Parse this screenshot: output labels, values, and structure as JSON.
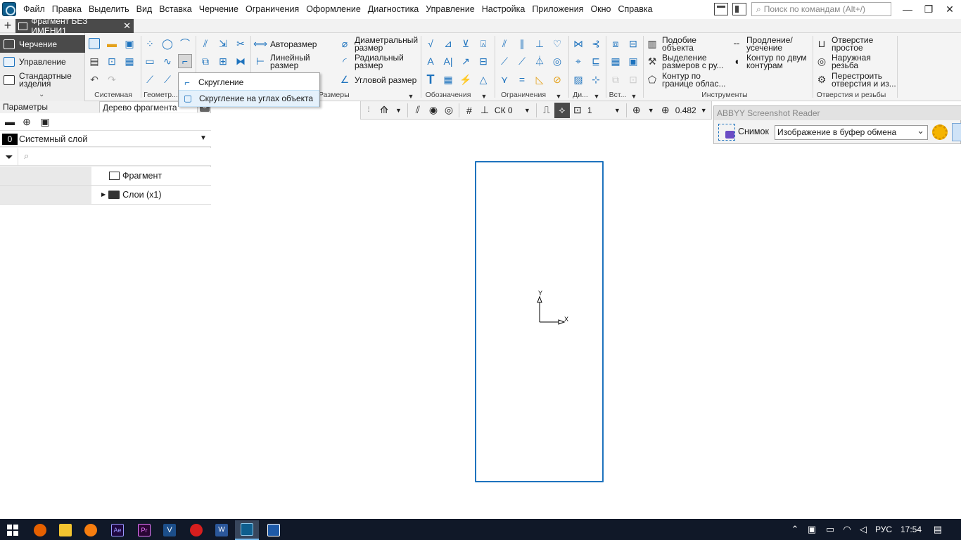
{
  "menu": {
    "items": [
      "Файл",
      "Правка",
      "Выделить",
      "Вид",
      "Вставка",
      "Черчение",
      "Ограничения",
      "Оформление",
      "Диагностика",
      "Управление",
      "Настройка",
      "Приложения",
      "Окно",
      "Справка"
    ],
    "search_placeholder": "Поиск по командам (Alt+/)"
  },
  "tabs": {
    "document_tab": "Фрагмент БЕЗ ИМЕНИ1"
  },
  "ribbon": {
    "left_tabs": [
      "Черчение",
      "Управление",
      "Стандартные изделия"
    ],
    "groups": [
      "Системная",
      "Геометр...",
      "Размеры",
      "Обозначения",
      "Ограничения",
      "Ди...",
      "Вст...",
      "Инструменты",
      "Отверстия и резьбы"
    ],
    "dimension_buttons": [
      "Авторазмер",
      "Линейный размер",
      "Диаметральный размер",
      "Радиальный размер",
      "Угловой размер"
    ],
    "tool_buttons": [
      "Подобие объекта",
      "Выделение размеров с ру...",
      "Контур по границе облас...",
      "Продление/ усечение",
      "Контур по двум контурам"
    ],
    "hole_buttons": [
      "Отверстие простое",
      "Наружная резьба",
      "Перестроить отверстия и из..."
    ]
  },
  "popup": {
    "items": [
      "Скругление",
      "Скругление на углах объекта"
    ]
  },
  "left_panel": {
    "tabs": [
      "Параметры",
      "Дерево фрагмента"
    ],
    "layer_number": "0",
    "layer_name": "Системный слой",
    "tree": [
      "Фрагмент",
      "Слои (x1)"
    ]
  },
  "view_toolbar": {
    "cs": "СК 0",
    "layer_value": "1",
    "zoom": "0.482"
  },
  "canvas": {
    "axis_x": "X",
    "axis_y": "Y"
  },
  "abbyy": {
    "title": "ABBYY Screenshot Reader",
    "label": "Снимок",
    "selected": "Изображение в буфер обмена"
  },
  "taskbar": {
    "tray_lang": "РУС",
    "tray_time": "17:54",
    "app_icons": [
      "windows-start",
      "firefox",
      "file-explorer",
      "avast",
      "after-effects",
      "premiere",
      "visio",
      "downloader",
      "word",
      "kompas",
      "kompas-viewer"
    ]
  }
}
